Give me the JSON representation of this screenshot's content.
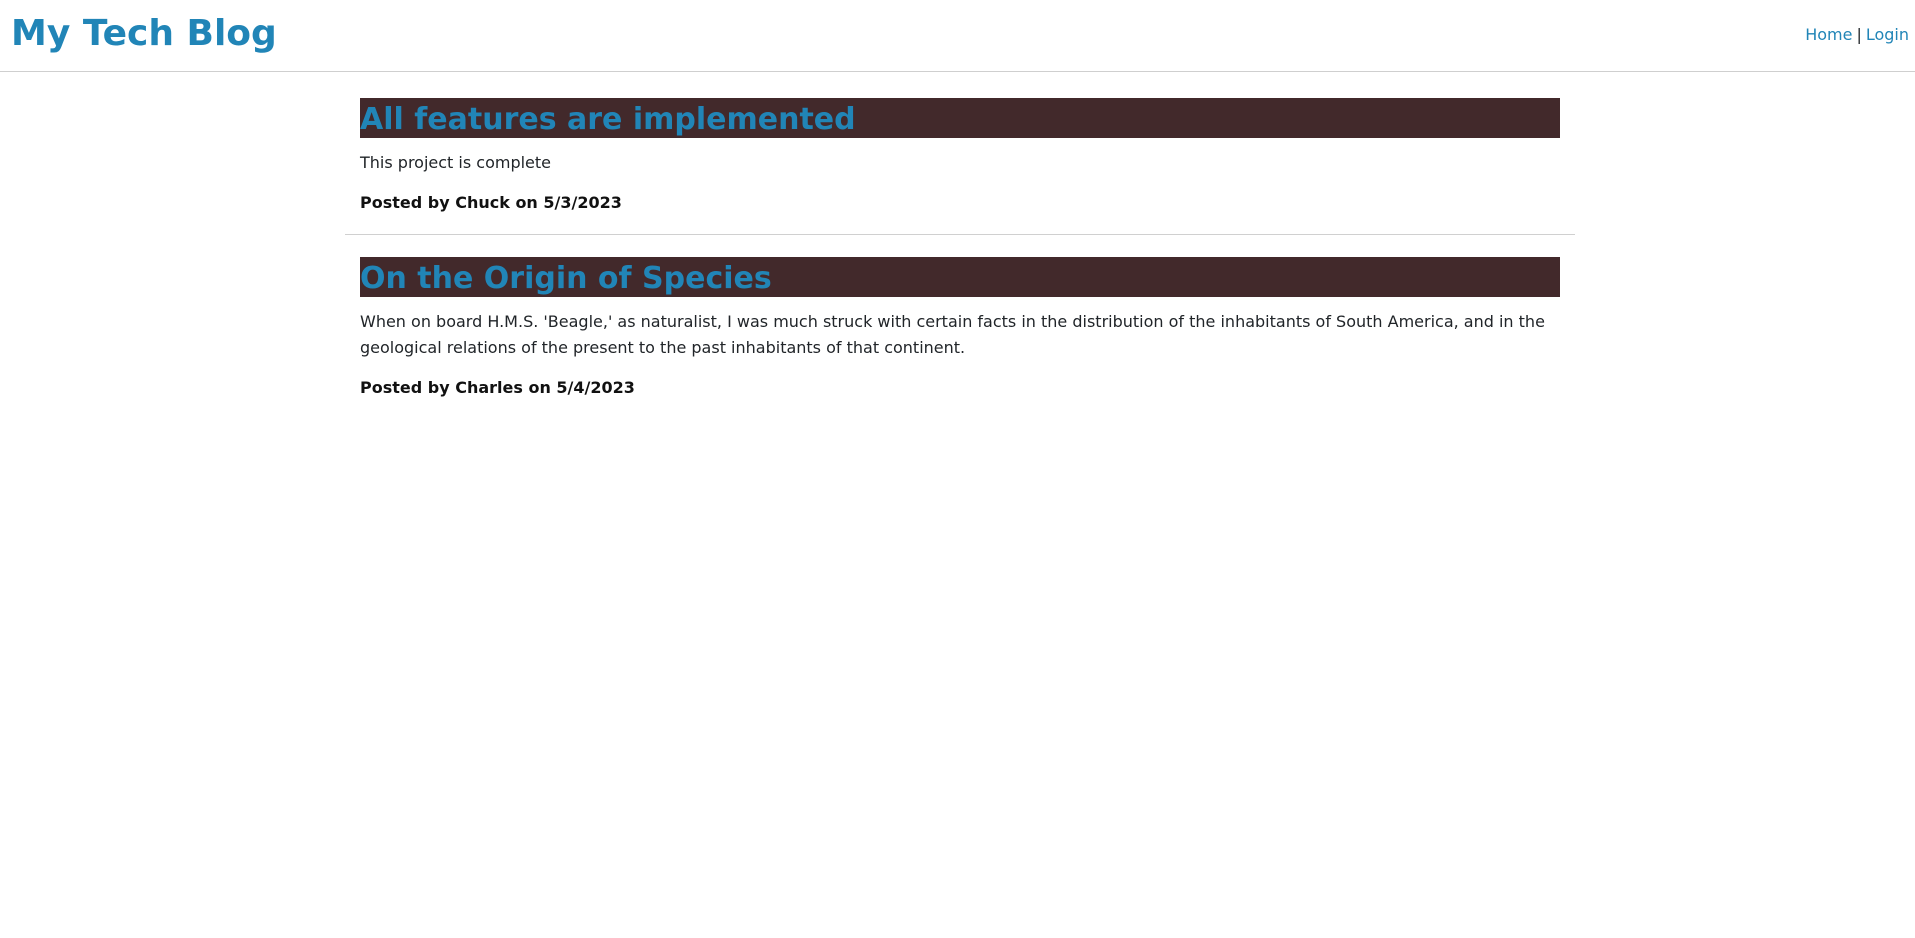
{
  "header": {
    "site_title": "My Tech Blog",
    "nav": {
      "home": "Home",
      "separator": "|",
      "login": "Login"
    }
  },
  "posts": [
    {
      "title": "All features are implemented",
      "body": "This project is complete",
      "meta": "Posted by Chuck on 5/3/2023"
    },
    {
      "title": "On the Origin of Species",
      "body": "When on board H.M.S. 'Beagle,' as naturalist, I was much struck with certain facts in the distribution of the inhabitants of South America, and in the geological relations of the present to the past inhabitants of that continent.",
      "meta": "Posted by Charles on 5/4/2023"
    }
  ],
  "colors": {
    "accent": "#2185b7",
    "title_bar": "#42292b",
    "divider": "#d0d0d0"
  }
}
